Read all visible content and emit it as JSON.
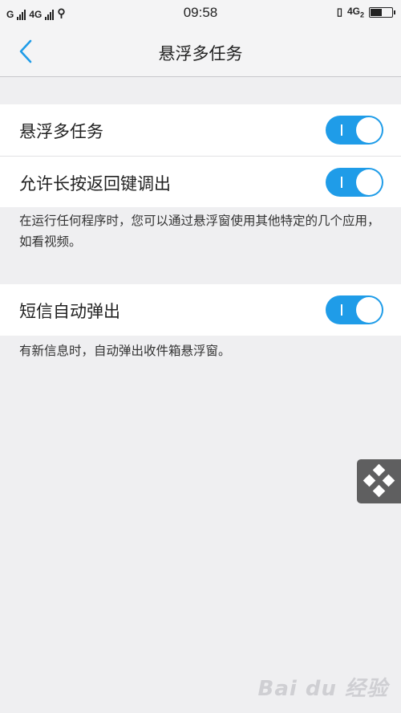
{
  "status_bar": {
    "carrier_left": "G",
    "network_1": "4G",
    "time": "09:58",
    "network_2": "4G",
    "network_2_sub": "2"
  },
  "header": {
    "title": "悬浮多任务"
  },
  "section1": {
    "rows": [
      {
        "label": "悬浮多任务",
        "toggle_on": true
      },
      {
        "label": "允许长按返回键调出",
        "toggle_on": true
      }
    ],
    "note": "在运行任何程序时，您可以通过悬浮窗使用其他特定的几个应用，如看视频。"
  },
  "section2": {
    "rows": [
      {
        "label": "短信自动弹出",
        "toggle_on": true
      }
    ],
    "note": "有新信息时，自动弹出收件箱悬浮窗。"
  },
  "watermark": "Bai du 经验",
  "colors": {
    "accent": "#1f9ce8",
    "background": "#efeff1",
    "surface": "#ffffff",
    "float_button": "#5f5f60"
  },
  "icons": {
    "back": "chevron-left-icon",
    "float": "diamond-grid-icon"
  }
}
